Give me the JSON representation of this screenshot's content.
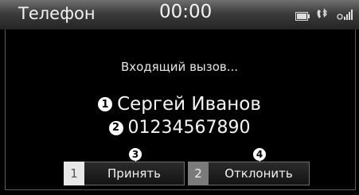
{
  "status_bar": {
    "app_title": "Телефон",
    "clock": "00:00",
    "icons": [
      "battery-icon",
      "bluetooth-phone-icon",
      "signal-strength-icon"
    ]
  },
  "call": {
    "status_text": "Входящий вызов...",
    "caller_name": "Сергей Иванов",
    "caller_number": "01234567890"
  },
  "callouts": {
    "name": "1",
    "number": "2",
    "accept": "3",
    "decline": "4"
  },
  "softkeys": [
    {
      "number": "1",
      "label": "Принять"
    },
    {
      "number": "2",
      "label": "Отклонить"
    }
  ],
  "colors": {
    "background": "#000000",
    "accept_number_bg": "#e8e8e8",
    "decline_number_bg": "#7a7a7a"
  }
}
